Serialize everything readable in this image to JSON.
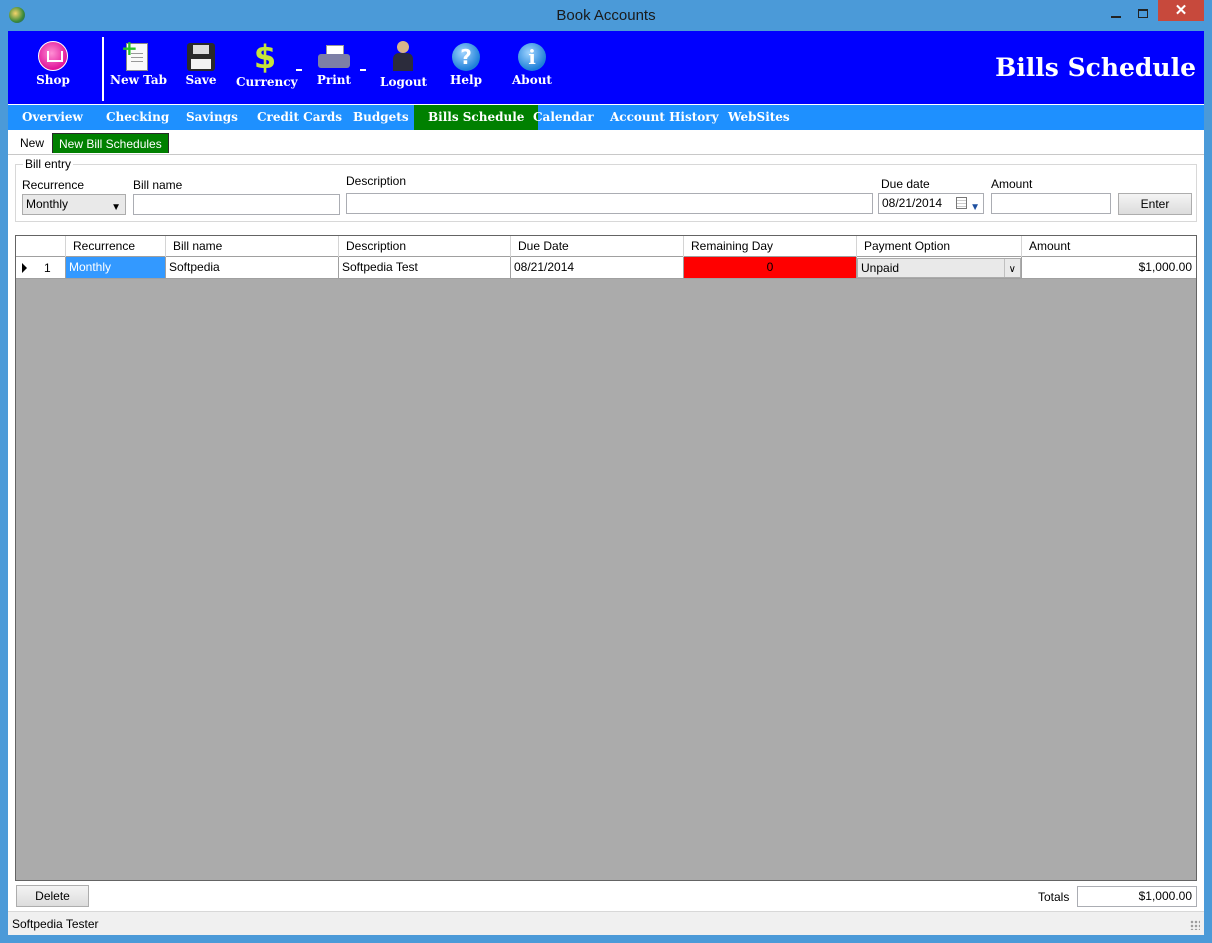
{
  "window": {
    "title": "Book Accounts",
    "close_glyph": "✕"
  },
  "toolbar": {
    "buttons": [
      {
        "label": "Shop",
        "icon": "shop-icon"
      },
      {
        "label": "New Tab",
        "icon": "new-document-icon"
      },
      {
        "label": "Save",
        "icon": "floppy-disk-icon"
      },
      {
        "label": "Currency",
        "icon": "dollar-icon",
        "glyph": "$"
      },
      {
        "label": "Print",
        "icon": "printer-icon"
      },
      {
        "label": "Logout",
        "icon": "user-lock-icon"
      },
      {
        "label": "Help",
        "icon": "help-icon",
        "glyph": "?"
      },
      {
        "label": "About",
        "icon": "info-icon",
        "glyph": "i"
      }
    ],
    "page_heading": "Bills Schedule",
    "accent_color": "#0000ff"
  },
  "nav": {
    "items": [
      {
        "label": "Overview"
      },
      {
        "label": "Checking"
      },
      {
        "label": "Savings"
      },
      {
        "label": "Credit Cards"
      },
      {
        "label": "Budgets"
      },
      {
        "label": "Bills Schedule",
        "active": true
      },
      {
        "label": "Calendar"
      },
      {
        "label": "Account History"
      },
      {
        "label": "WebSites"
      }
    ],
    "bar_color": "#1e90ff",
    "active_color": "#008000"
  },
  "subtabs": [
    {
      "label": "New"
    },
    {
      "label": "New Bill Schedules",
      "active": true
    }
  ],
  "bill_entry": {
    "group_title": "Bill entry",
    "recurrence_label": "Recurrence",
    "recurrence_value": "Monthly",
    "bill_name_label": "Bill name",
    "bill_name_value": "",
    "description_label": "Description",
    "description_value": "",
    "due_date_label": "Due date",
    "due_date_value": "08/21/2014",
    "amount_label": "Amount",
    "amount_value": "",
    "enter_button": "Enter"
  },
  "grid": {
    "columns": [
      "Recurrence",
      "Bill name",
      "Description",
      "Due Date",
      "Remaining Day",
      "Payment Option",
      "Amount"
    ],
    "rows": [
      {
        "row_number": "1",
        "recurrence": "Monthly",
        "bill_name": "Softpedia",
        "description": "Softpedia Test",
        "due_date": "08/21/2014",
        "remaining_day": "0",
        "payment_option": "Unpaid",
        "amount": "$1,000.00"
      }
    ],
    "overdue_color": "#ff0000"
  },
  "footer": {
    "delete_button": "Delete",
    "totals_label": "Totals",
    "totals_value": "$1,000.00"
  },
  "status": {
    "user": "Softpedia Tester"
  }
}
